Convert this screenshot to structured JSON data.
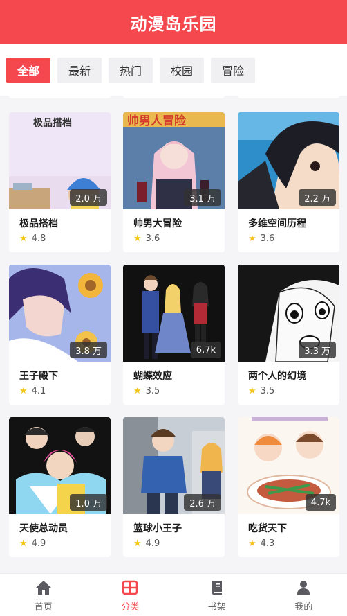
{
  "app": {
    "title": "动漫岛乐园"
  },
  "tabs": [
    {
      "label": "全部",
      "active": true
    },
    {
      "label": "最新",
      "active": false
    },
    {
      "label": "热门",
      "active": false
    },
    {
      "label": "校园",
      "active": false
    },
    {
      "label": "冒险",
      "active": false
    }
  ],
  "cards": [
    {
      "title": "极品搭档",
      "views": "2.0 万",
      "rating": "4.8",
      "cover_text": "极品搭档"
    },
    {
      "title": "帅男大冒险",
      "views": "3.1 万",
      "rating": "3.6",
      "cover_text": "帅男人冒险"
    },
    {
      "title": "多维空间历程",
      "views": "2.2 万",
      "rating": "3.6"
    },
    {
      "title": "王子殿下",
      "views": "3.8 万",
      "rating": "4.1"
    },
    {
      "title": "蝴蝶效应",
      "views": "6.7k",
      "rating": "3.5"
    },
    {
      "title": "两个人的幻境",
      "views": "3.3 万",
      "rating": "3.5"
    },
    {
      "title": "天使总动员",
      "views": "1.0 万",
      "rating": "4.9"
    },
    {
      "title": "篮球小王子",
      "views": "2.6 万",
      "rating": "4.9"
    },
    {
      "title": "吃货天下",
      "views": "4.7k",
      "rating": "4.3"
    }
  ],
  "nav": [
    {
      "label": "首页",
      "icon": "home-icon",
      "active": false
    },
    {
      "label": "分类",
      "icon": "category-grid-icon",
      "active": true
    },
    {
      "label": "书架",
      "icon": "bookshelf-icon",
      "active": false
    },
    {
      "label": "我的",
      "icon": "user-icon",
      "active": false
    }
  ],
  "colors": {
    "accent": "#f5484e",
    "star": "#f5c518",
    "background": "#f5f5f7"
  }
}
